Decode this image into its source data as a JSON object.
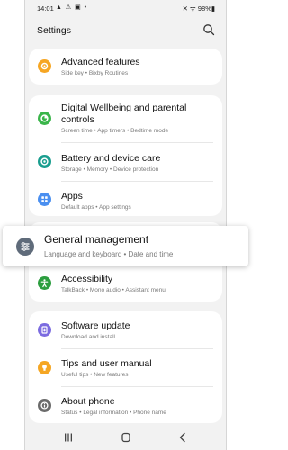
{
  "status_bar": {
    "time": "14:01",
    "left_icons": "▲ ⚠ ▣ •",
    "right": "✕ ᯤ 98%▮"
  },
  "header": {
    "title": "Settings"
  },
  "items": [
    {
      "title": "Advanced features",
      "subtitle": "Side key  •  Bixby Routines",
      "color": "#f6a623",
      "icon": "gear-plus-icon"
    },
    {
      "title": "Digital Wellbeing and parental controls",
      "title_line1": "Digital Wellbeing and parental",
      "title_line2": "controls",
      "subtitle": "Screen time  •  App timers  •  Bedtime mode",
      "color": "#3ab54a",
      "icon": "wellbeing-icon"
    },
    {
      "title": "Battery and device care",
      "subtitle": "Storage  •  Memory  •  Device protection",
      "color": "#1a9e8f",
      "icon": "device-care-icon"
    },
    {
      "title": "Apps",
      "subtitle": "Default apps  •  App settings",
      "color": "#4a8ff0",
      "icon": "apps-grid-icon"
    },
    {
      "title": "General management",
      "subtitle": "Language and keyboard  •  Date and time",
      "color": "#5f6b7a",
      "icon": "sliders-icon"
    },
    {
      "title": "Accessibility",
      "subtitle": "TalkBack  •  Mono audio  •  Assistant menu",
      "color": "#2c9e3f",
      "icon": "accessibility-icon"
    },
    {
      "title": "Software update",
      "subtitle": "Download and install",
      "color": "#7b6be0",
      "icon": "software-update-icon"
    },
    {
      "title": "Tips and user manual",
      "subtitle": "Useful tips  •  New features",
      "color": "#f5a623",
      "icon": "lightbulb-icon"
    },
    {
      "title": "About phone",
      "subtitle": "Status  •  Legal information  •  Phone name",
      "color": "#6b6b6b",
      "icon": "info-icon"
    }
  ]
}
